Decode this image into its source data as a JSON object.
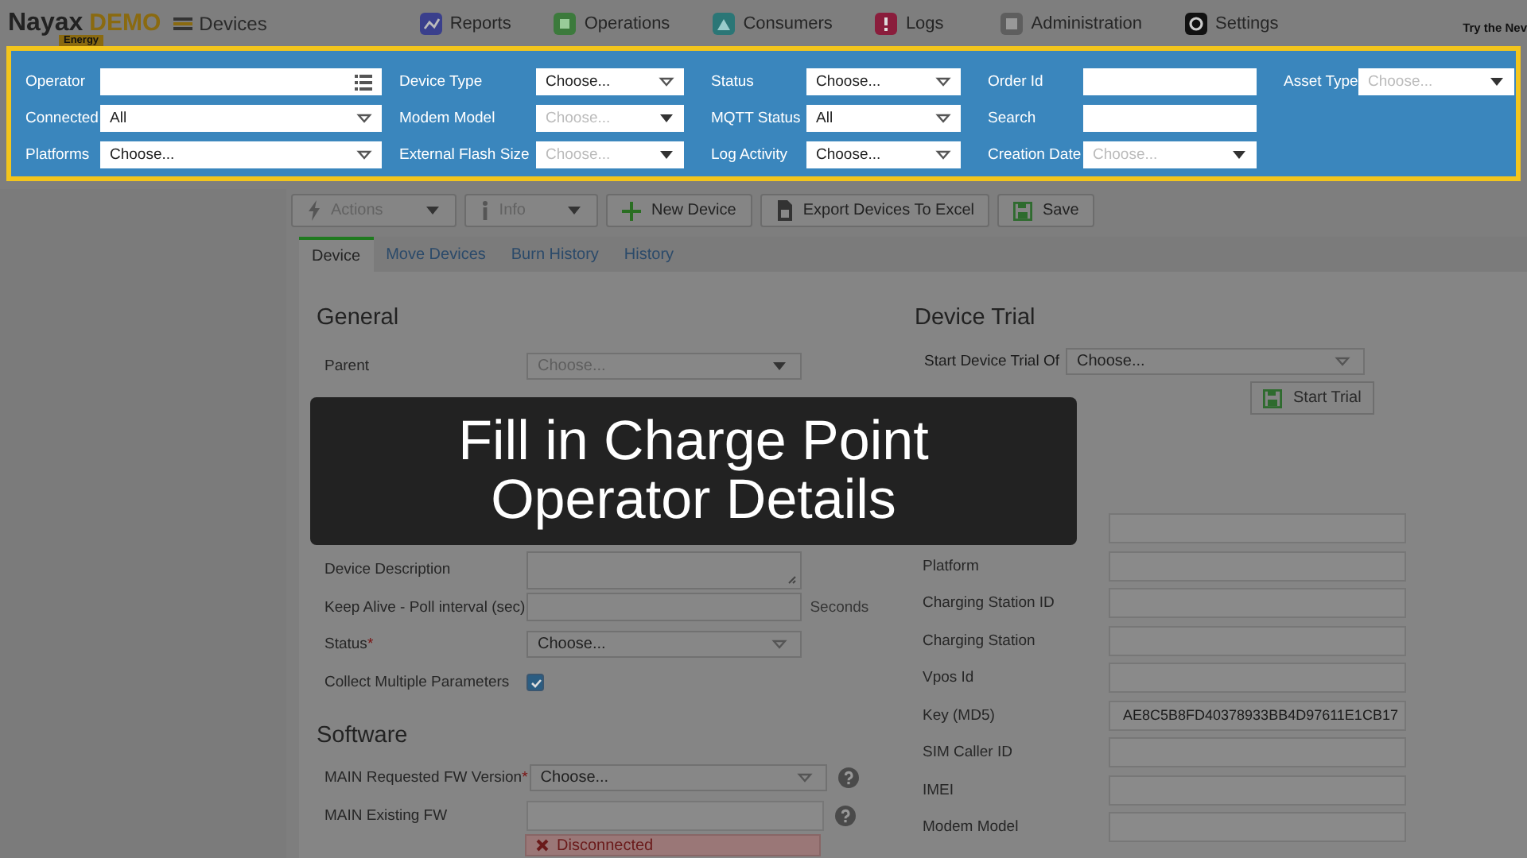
{
  "topbar": {
    "logo": "Nayax",
    "logo_suffix": "DEMO",
    "logo_badge": "Energy",
    "page_title": "Devices",
    "nav": [
      {
        "label": "Reports"
      },
      {
        "label": "Operations"
      },
      {
        "label": "Consumers"
      },
      {
        "label": "Logs"
      },
      {
        "label": "Administration"
      },
      {
        "label": "Settings"
      }
    ],
    "promo": "Try the Nev"
  },
  "filter_columns": [
    [
      {
        "label": "Operator",
        "kind": "list"
      },
      {
        "label": "Connected",
        "kind": "select",
        "value": "All",
        "disabled": false
      },
      {
        "label": "Platforms",
        "kind": "select",
        "value": "Choose...",
        "disabled": false
      }
    ],
    [
      {
        "label": "Device Type",
        "kind": "select",
        "value": "Choose...",
        "disabled": false
      },
      {
        "label": "Modem Model",
        "kind": "select",
        "placeholder": "Choose...",
        "disabled": true
      },
      {
        "label": "External Flash Size",
        "kind": "select",
        "placeholder": "Choose...",
        "disabled": true
      }
    ],
    [
      {
        "label": "Status",
        "kind": "select",
        "value": "Choose...",
        "disabled": false
      },
      {
        "label": "MQTT Status",
        "kind": "select",
        "value": "All",
        "disabled": false
      },
      {
        "label": "Log Activity",
        "kind": "select",
        "value": "Choose...",
        "disabled": false
      }
    ],
    [
      {
        "label": "Order Id",
        "kind": "text"
      },
      {
        "label": "Search",
        "kind": "text"
      },
      {
        "label": "Creation Date",
        "kind": "select",
        "placeholder": "Choose...",
        "disabled": true
      }
    ],
    [
      {
        "label": "Asset Type",
        "kind": "select",
        "placeholder": "Choose...",
        "disabled": true
      }
    ]
  ],
  "toolbar": [
    {
      "label": "Actions",
      "disabled": true,
      "dropdown": true
    },
    {
      "label": "Info",
      "disabled": true,
      "dropdown": true
    },
    {
      "label": "New Device",
      "disabled": false,
      "dropdown": false
    },
    {
      "label": "Export Devices To Excel",
      "disabled": false,
      "dropdown": false
    },
    {
      "label": "Save",
      "disabled": false,
      "dropdown": false
    }
  ],
  "tabs": [
    {
      "label": "Device",
      "selected": true
    },
    {
      "label": "Move Devices",
      "selected": false
    },
    {
      "label": "Burn History",
      "selected": false
    },
    {
      "label": "History",
      "selected": false
    }
  ],
  "general": {
    "title": "General",
    "fields": [
      {
        "label": "Parent",
        "kind": "select",
        "placeholder": "Choose...",
        "disabled": true
      },
      {
        "kind": "hidden"
      },
      {
        "label": "Device Description",
        "kind": "textarea"
      },
      {
        "label": "Keep Alive - Poll interval (sec)",
        "kind": "text",
        "suffix": "Seconds"
      },
      {
        "label": "Status",
        "mark": "*",
        "kind": "select",
        "value": "Choose...",
        "disabled": false
      },
      {
        "label": "Collect Multiple Parameters",
        "kind": "checkbox",
        "checked": true
      }
    ]
  },
  "software": {
    "title": "Software",
    "fields": [
      {
        "label": "MAIN Requested FW Version",
        "mark": "*",
        "kind": "select",
        "value": "Choose...",
        "disabled": false,
        "help": true
      },
      {
        "label": "MAIN Existing FW",
        "kind": "readonly",
        "help": true
      },
      {
        "kind": "alert",
        "value": "Disconnected"
      }
    ]
  },
  "device_trial": {
    "title": "Device Trial",
    "label": "Start Device Trial Of",
    "value": "Choose...",
    "button": "Start Trial"
  },
  "hardware": {
    "fields": [
      {
        "kind": "readonly"
      },
      {
        "label": "Platform",
        "kind": "readonly"
      },
      {
        "label": "Charging Station ID",
        "kind": "readonly"
      },
      {
        "label": "Charging Station",
        "kind": "readonly"
      },
      {
        "label": "Vpos Id",
        "kind": "readonly"
      },
      {
        "label": "Key (MD5)",
        "kind": "readonly",
        "value": "AE8C5B8FD40378933BB4D97611E1CB17"
      },
      {
        "label": "SIM Caller ID",
        "kind": "readonly"
      },
      {
        "label": "IMEI",
        "kind": "readonly"
      },
      {
        "label": "Modem Model",
        "kind": "readonly"
      }
    ]
  },
  "overlay": {
    "text": "Fill in Charge Point Operator Details"
  }
}
